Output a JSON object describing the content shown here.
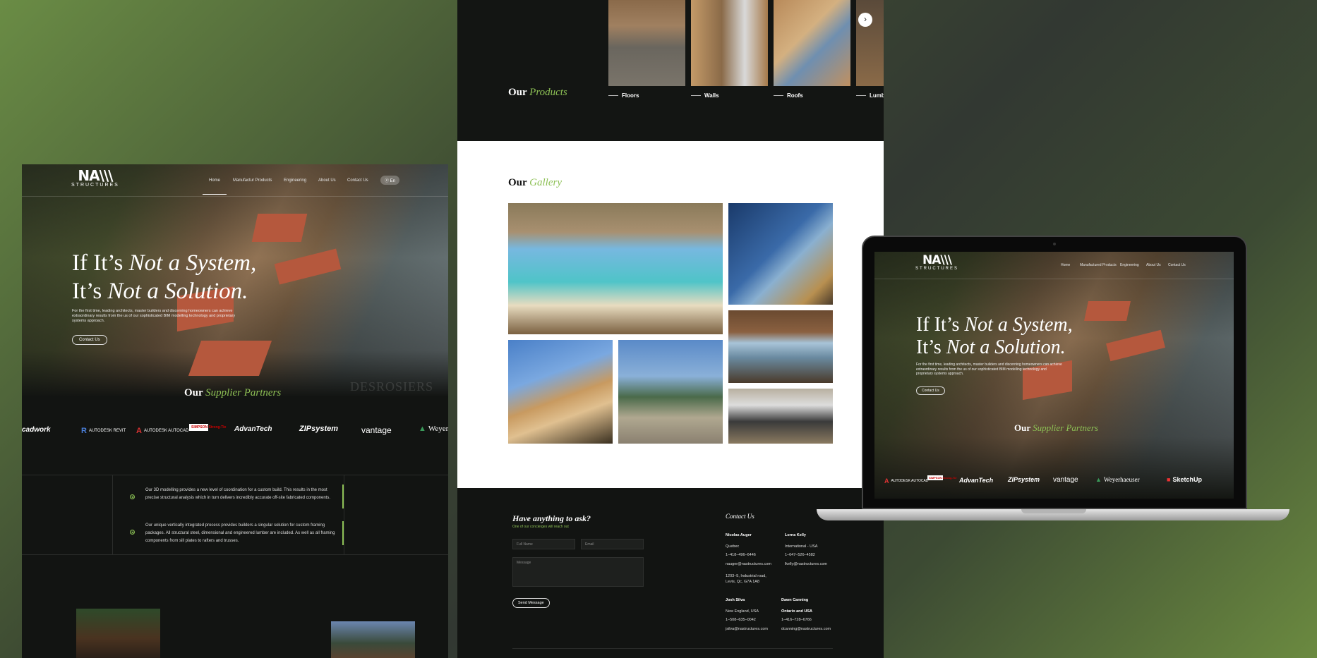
{
  "left": {
    "logo": {
      "mark": "NA\\\\\\",
      "text": "STRUCTURES"
    },
    "nav": [
      "Home",
      "Manufactur Products",
      "Engineering",
      "About Us",
      "Contact Us"
    ],
    "lang": "ⓔ En",
    "hero": {
      "line1a": "If It’s ",
      "line1b": "Not a System,",
      "line2a": "It’s ",
      "line2b": "Not a Solution.",
      "body": "For the first time, leading architects, master builders and discerning homeowners can achieve extraordinary results from the us of our sophisticated BIM modelling technology and proprietary systems approach.",
      "cta": "Contact Us",
      "watermark": "DESROSIERS"
    },
    "partners": {
      "title_a": "Our ",
      "title_b": "Supplier Partners",
      "logos": [
        "cadwork",
        "AUTODESK REVIT",
        "AUTODESK AUTOCAD",
        "SIMPSON Strong-Tie",
        "AdvanTech",
        "ZIPsystem",
        "vantage",
        "Weyer"
      ]
    },
    "features": [
      "Our 3D modelling provides a new level of coordination for a custom build. This results in the most precise structural analysis which in turn delivers incredibly accurate off-site fabricated components.",
      "Our unique vertically integrated process provides builders a singular solution for custom framing packages. All structural steel, dimensional and engineered lumber are included. As well as all framing components from sill plates to rafters and trusses."
    ]
  },
  "mid": {
    "products": {
      "title_a": "Our ",
      "title_b": "Products",
      "items": [
        "Floors",
        "Walls",
        "Roofs",
        "Lumb"
      ],
      "next": "›"
    },
    "gallery": {
      "title_a": "Our ",
      "title_b": "Gallery"
    },
    "contact": {
      "title": "Have anything to ask?",
      "subtitle": "One of our concierges will reach out",
      "fullname_ph": "Full Name",
      "email_ph": "Email",
      "message_ph": "Message",
      "send": "Send Message",
      "heading": "Contact Us",
      "people": [
        {
          "name": "Nicolas Auger",
          "lines": [
            "Quebec",
            "1–418–496–6446",
            "nauger@nastructures.com",
            "1203–5, Industrial road,",
            "Levis, Qc, G7A 1A8"
          ]
        },
        {
          "name": "Lorna Kelly",
          "lines": [
            "International - USA",
            "1–647–526–4582",
            "lkelly@nastructures.com"
          ]
        },
        {
          "name": "Josh Silva",
          "lines": [
            "New England, USA",
            "1–508–635–0042",
            "jsilva@nastructures.com"
          ]
        },
        {
          "name": "Dawn Canning",
          "lines": [
            "Ontario and USA",
            "1–416–728–6766",
            "dcanning@nastructures.com"
          ]
        }
      ]
    }
  },
  "laptop": {
    "nav": [
      "Home",
      "Manufactured Products",
      "Engineering",
      "About Us",
      "Contact Us"
    ],
    "partners": [
      "AUTODESK AUTOCAD",
      "SIMPSON Strong-Tie",
      "AdvanTech",
      "ZIPsystem",
      "vantage",
      "Weyerhaeuser",
      "SketchUp"
    ]
  },
  "colors": {
    "accent": "#8dc055",
    "dark": "#121412"
  }
}
